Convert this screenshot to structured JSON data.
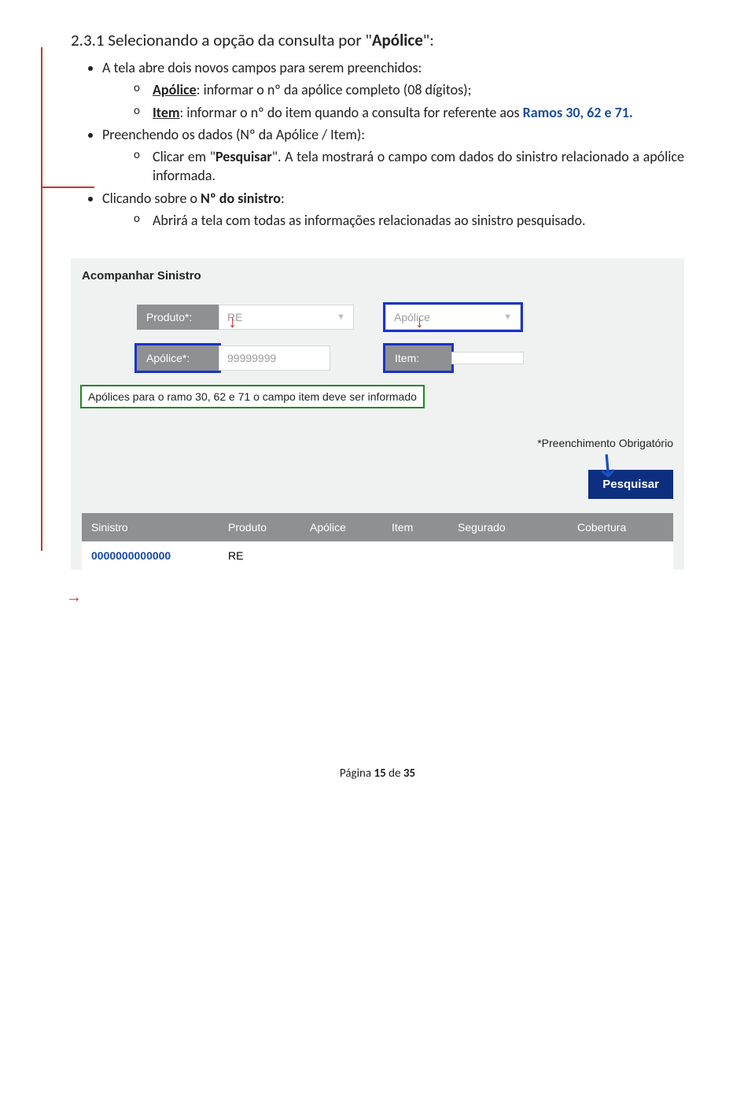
{
  "section": {
    "title_num": "2.3.1",
    "title_rest": " Selecionando a opção da consulta por \"",
    "title_kw": "Apólice",
    "title_end": "\":"
  },
  "b1": {
    "intro": "A tela abre dois novos campos para serem preenchidos:",
    "s1_label": "Apólice",
    "s1_text": ": informar o nº da apólice completo (08 dígitos);",
    "s2_label": "Item",
    "s2_text_a": ": informar o nº do item quando a consulta for referente aos ",
    "s2_text_b": "Ramos 30, 62 e 71.",
    "s2_text_c": ""
  },
  "b2": {
    "intro": "Preenchendo os dados (Nº da Apólice / Item):",
    "s1_a": "Clicar em \"",
    "s1_b": "Pesquisar",
    "s1_c": "\". A tela mostrará o campo com dados do sinistro relacionado a apólice informada."
  },
  "b3": {
    "intro_a": "Clicando sobre o ",
    "intro_b": "Nº do sinistro",
    "intro_c": ":",
    "s1": "Abrirá a tela com todas as informações relacionadas ao sinistro pesquisado."
  },
  "mock": {
    "title": "Acompanhar Sinistro",
    "produto_label": "Produto*:",
    "produto_value": "RE",
    "tipo_value": "Apólice",
    "apolice_label": "Apólice*:",
    "apolice_value": "99999999",
    "item_label": "Item:",
    "hint": "Apólices para o ramo 30, 62 e 71 o campo item deve ser informado",
    "obrigatorio": "*Preenchimento Obrigatório",
    "pesquisar": "Pesquisar",
    "headers": {
      "sinistro": "Sinistro",
      "produto": "Produto",
      "apolice": "Apólice",
      "item": "Item",
      "segurado": "Segurado",
      "cobertura": "Cobertura"
    },
    "row": {
      "sinistro": "0000000000000",
      "produto": "RE",
      "apolice": "",
      "item": "",
      "segurado": "",
      "cobertura": ""
    }
  },
  "footer": {
    "prefix": "Página ",
    "page": "15",
    "sep": " de ",
    "total": "35"
  }
}
